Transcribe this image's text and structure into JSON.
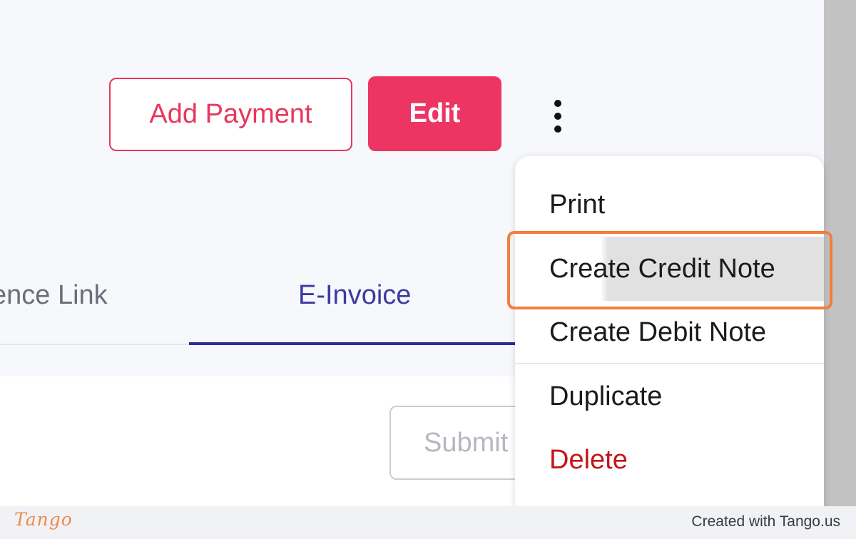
{
  "header": {
    "add_payment_label": "Add Payment",
    "edit_label": "Edit"
  },
  "tabs": [
    {
      "label": "ence Link"
    },
    {
      "label": "E-Invoice",
      "active": true
    }
  ],
  "panel": {
    "submit_label": "Submit"
  },
  "menu": {
    "items": [
      {
        "label": "Print"
      },
      {
        "label": "Create Credit Note",
        "highlighted": true
      },
      {
        "label": "Create Debit Note"
      },
      {
        "label": "Duplicate"
      },
      {
        "label": "Delete",
        "color": "#c4141b"
      }
    ]
  },
  "footer": {
    "logo_text": "Tango",
    "credit_text": "Created with Tango.us"
  },
  "colors": {
    "accent": "#ed3563",
    "tab_active": "#2d2a9a",
    "highlight": "#f47c3c",
    "danger": "#c4141b"
  }
}
